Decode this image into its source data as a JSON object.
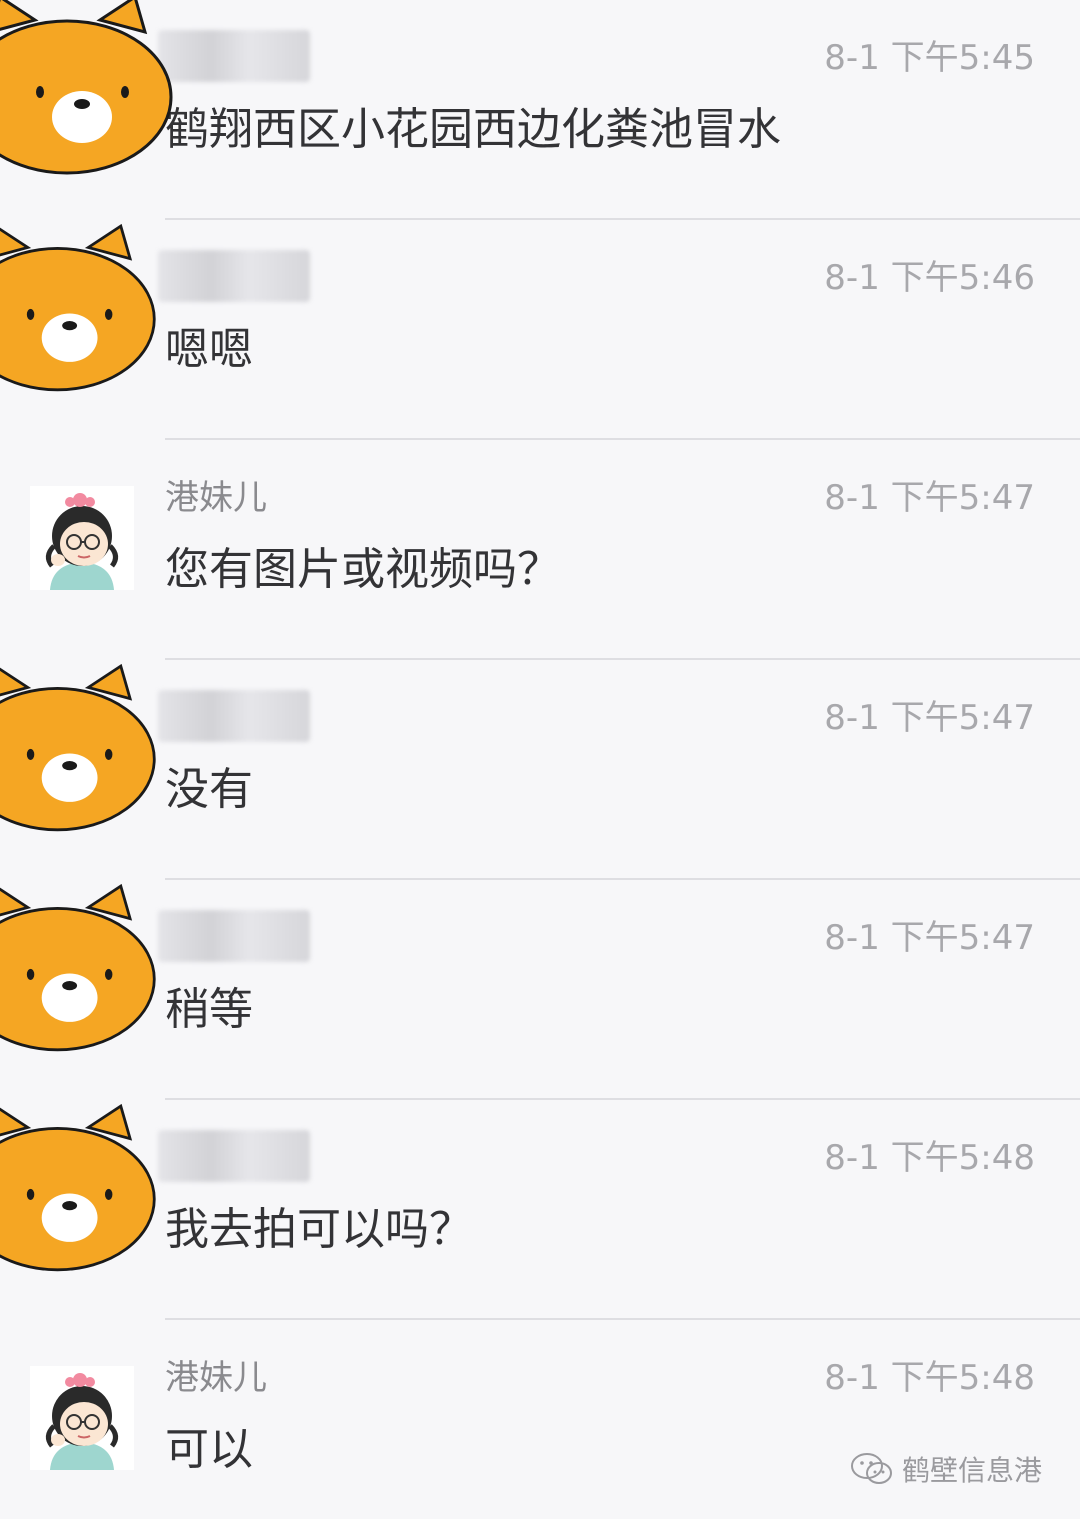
{
  "messages": [
    {
      "sender": "",
      "sender_blurred": true,
      "avatar": "bear-avatar-icon",
      "time": "8-1 下午5:45",
      "text": "鹤翔西区小花园西边化粪池冒水"
    },
    {
      "sender": "",
      "sender_blurred": true,
      "avatar": "bear-avatar-icon",
      "time": "8-1 下午5:46",
      "text": "嗯嗯"
    },
    {
      "sender": "港妹儿",
      "sender_blurred": false,
      "avatar": "girl-avatar-icon",
      "time": "8-1 下午5:47",
      "text": "您有图片或视频吗？"
    },
    {
      "sender": "",
      "sender_blurred": true,
      "avatar": "bear-avatar-icon",
      "time": "8-1 下午5:47",
      "text": "没有"
    },
    {
      "sender": "",
      "sender_blurred": true,
      "avatar": "bear-avatar-icon",
      "time": "8-1 下午5:47",
      "text": "稍等"
    },
    {
      "sender": "",
      "sender_blurred": true,
      "avatar": "bear-avatar-icon",
      "time": "8-1 下午5:48",
      "text": "我去拍可以吗？"
    },
    {
      "sender": "港妹儿",
      "sender_blurred": false,
      "avatar": "girl-avatar-icon",
      "time": "8-1 下午5:48",
      "text": "可以"
    }
  ],
  "watermark": {
    "icon": "wechat-icon",
    "text": "鹤壁信息港"
  },
  "colors": {
    "background": "#f7f7f9",
    "bear_fur": "#f5a623",
    "bear_outline": "#1a1a1a",
    "time_text": "#a8a8ac",
    "message_text": "#333336"
  }
}
